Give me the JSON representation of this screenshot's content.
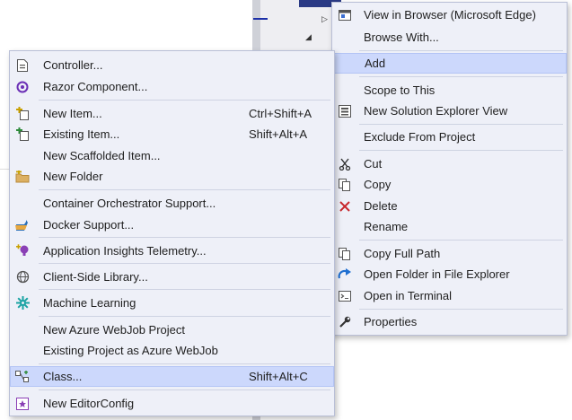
{
  "main_menu": {
    "items": [
      {
        "label": "View in Browser (Microsoft Edge)",
        "icon": "browser-view-icon"
      },
      {
        "label": "Browse With...",
        "icon": ""
      },
      {
        "label": "Add",
        "icon": ""
      },
      {
        "label": "Scope to This",
        "icon": ""
      },
      {
        "label": "New Solution Explorer View",
        "icon": "solution-explorer-icon"
      },
      {
        "label": "Exclude From Project",
        "icon": ""
      },
      {
        "label": "Cut",
        "icon": "cut-icon"
      },
      {
        "label": "Copy",
        "icon": "copy-icon"
      },
      {
        "label": "Delete",
        "icon": "delete-icon"
      },
      {
        "label": "Rename",
        "icon": ""
      },
      {
        "label": "Copy Full Path",
        "icon": "copy-path-icon"
      },
      {
        "label": "Open Folder in File Explorer",
        "icon": "open-folder-icon"
      },
      {
        "label": "Open in Terminal",
        "icon": "terminal-icon"
      },
      {
        "label": "Properties",
        "icon": "properties-icon"
      }
    ]
  },
  "add_submenu": {
    "items": [
      {
        "label": "Controller...",
        "shortcut": "",
        "icon": "controller-icon"
      },
      {
        "label": "Razor Component...",
        "shortcut": "",
        "icon": "razor-icon"
      },
      {
        "label": "New Item...",
        "shortcut": "Ctrl+Shift+A",
        "icon": "new-item-icon"
      },
      {
        "label": "Existing Item...",
        "shortcut": "Shift+Alt+A",
        "icon": "existing-item-icon"
      },
      {
        "label": "New Scaffolded Item...",
        "shortcut": "",
        "icon": ""
      },
      {
        "label": "New Folder",
        "shortcut": "",
        "icon": "new-folder-icon"
      },
      {
        "label": "Container Orchestrator Support...",
        "shortcut": "",
        "icon": ""
      },
      {
        "label": "Docker Support...",
        "shortcut": "",
        "icon": "docker-icon"
      },
      {
        "label": "Application Insights Telemetry...",
        "shortcut": "",
        "icon": "app-insights-icon"
      },
      {
        "label": "Client-Side Library...",
        "shortcut": "",
        "icon": "client-library-icon"
      },
      {
        "label": "Machine Learning",
        "shortcut": "",
        "icon": "machine-learning-icon"
      },
      {
        "label": "New Azure WebJob Project",
        "shortcut": "",
        "icon": ""
      },
      {
        "label": "Existing Project as Azure WebJob",
        "shortcut": "",
        "icon": ""
      },
      {
        "label": "Class...",
        "shortcut": "Shift+Alt+C",
        "icon": "class-icon"
      },
      {
        "label": "New EditorConfig",
        "shortcut": "",
        "icon": "editorconfig-icon"
      }
    ]
  }
}
